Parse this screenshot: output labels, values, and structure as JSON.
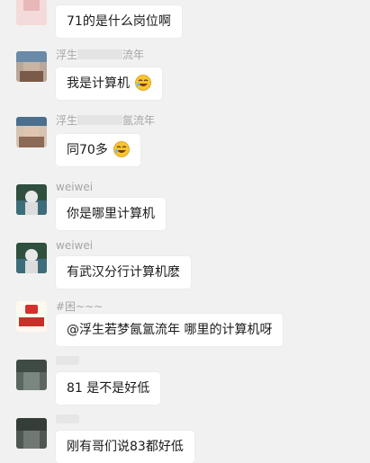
{
  "messages": [
    {
      "name": "",
      "text": "71的是什么岗位啊",
      "emoji": false
    },
    {
      "name": "浮生",
      "name_tail": "流年",
      "text": "我是计算机",
      "emoji": true
    },
    {
      "name": "浮生",
      "name_tail": "氤流年",
      "text": "同70多",
      "emoji": true
    },
    {
      "name": "weiwei",
      "text": "你是哪里计算机",
      "emoji": false
    },
    {
      "name": "weiwei",
      "text": "有武汉分行计算机麽",
      "emoji": false
    },
    {
      "name": "#困~~~",
      "text": "@浮生若梦氤氲流年 哪里的计算机呀",
      "emoji": false
    },
    {
      "name": "",
      "text": "81  是不是好低",
      "emoji": false
    },
    {
      "name": "",
      "text": "刚有哥们说83都好低",
      "emoji": false
    }
  ],
  "colors": {
    "background": "#f1f1f1",
    "bubble": "#ffffff",
    "name": "#a6a6a6"
  }
}
